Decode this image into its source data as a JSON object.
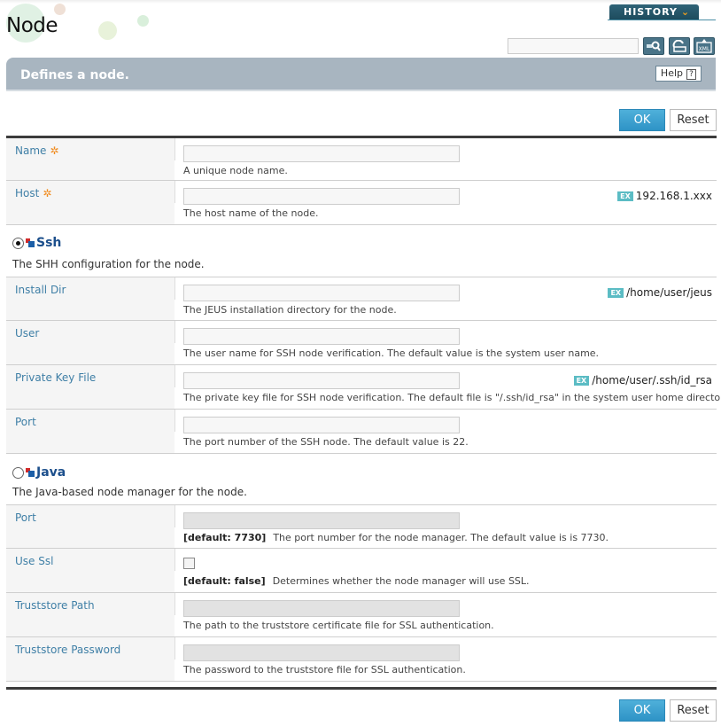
{
  "page": {
    "title": "Node",
    "history_label": "HISTORY",
    "banner_text": "Defines a node.",
    "help_label": "Help",
    "help_icon": "?",
    "search_placeholder": ""
  },
  "actions": {
    "ok_label": "OK",
    "reset_label": "Reset"
  },
  "colors": {
    "accent": "#2e93c6",
    "label": "#3f7fa6",
    "required": "#f08a1c",
    "banner": "#a8b5c0",
    "history": "#2f6377"
  },
  "fields_general": [
    {
      "label": "Name",
      "required": true,
      "value": "",
      "description": "A unique node name.",
      "example": ""
    },
    {
      "label": "Host",
      "required": true,
      "value": "",
      "description": "The host name of the node.",
      "example": "192.168.1.xxx"
    }
  ],
  "ssh": {
    "title": "Ssh",
    "selected": true,
    "description": "The SHH configuration for the node.",
    "fields": [
      {
        "label": "Install Dir",
        "value": "",
        "description": "The JEUS installation directory for the node.",
        "example": "/home/user/jeus"
      },
      {
        "label": "User",
        "value": "",
        "description": "The user name for SSH node verification. The default value is the system user name.",
        "example": ""
      },
      {
        "label": "Private Key File",
        "value": "",
        "description": "The private key file for SSH node verification. The default file is \"/.ssh/id_rsa\" in the system user home directory.",
        "example": "/home/user/.ssh/id_rsa"
      },
      {
        "label": "Port",
        "value": "",
        "description": "The port number of the SSH node. The default value is 22.",
        "example": ""
      }
    ]
  },
  "java": {
    "title": "Java",
    "selected": false,
    "description": "The Java-based node manager for the node.",
    "fields": [
      {
        "label": "Port",
        "value": "",
        "default": "[default: 7730]",
        "description": "The port number for the node manager. The default value is is 7730."
      },
      {
        "label": "Use Ssl",
        "checked": false,
        "default": "[default: false]",
        "description": "Determines whether the node manager will use SSL."
      },
      {
        "label": "Truststore Path",
        "value": "",
        "description": "The path to the truststore certificate file for SSL authentication."
      },
      {
        "label": "Truststore Password",
        "value": "",
        "description": "The password to the truststore file for SSL authentication."
      }
    ]
  },
  "example_badge": "EX",
  "required_mark": "✲"
}
